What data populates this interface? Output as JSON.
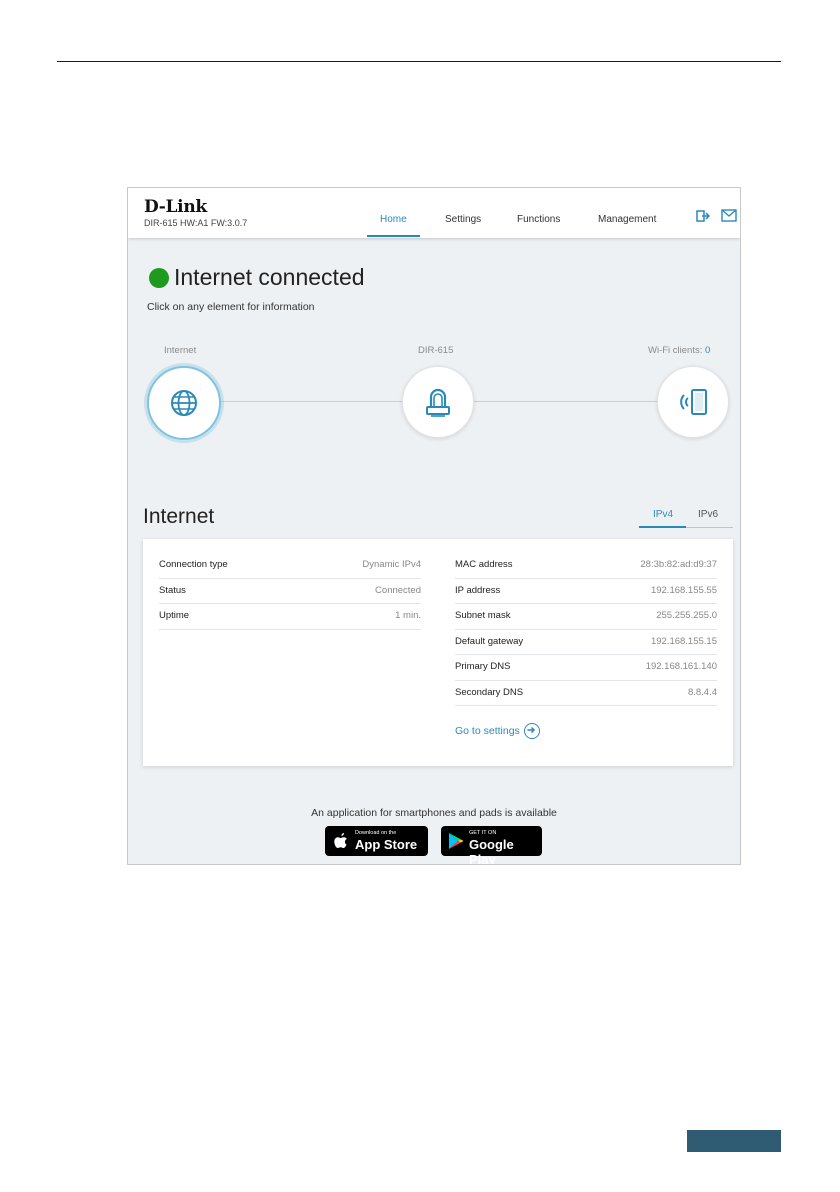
{
  "header": {
    "logo_text": "D-Link",
    "model_text": "DIR-615 HW:A1 FW:3.0.7",
    "nav": [
      {
        "label": "Home",
        "active": true
      },
      {
        "label": "Settings",
        "active": false
      },
      {
        "label": "Functions",
        "active": false
      },
      {
        "label": "Management",
        "active": false
      }
    ],
    "icons": [
      "logout-icon",
      "mail-icon"
    ]
  },
  "status": {
    "title": "Internet connected",
    "color": "#1e9a1e",
    "hint": "Click on any element for information"
  },
  "topology": {
    "internet_label": "Internet",
    "router_label": "DIR-615",
    "wifi_label": "Wi-Fi clients:",
    "wifi_count": "0"
  },
  "section": {
    "title": "Internet",
    "tabs": [
      {
        "label": "IPv4",
        "active": true
      },
      {
        "label": "IPv6",
        "active": false
      }
    ]
  },
  "left_table": [
    {
      "key": "Connection type",
      "value": "Dynamic IPv4"
    },
    {
      "key": "Status",
      "value": "Connected"
    },
    {
      "key": "Uptime",
      "value": "1 min."
    }
  ],
  "right_table": [
    {
      "key": "MAC address",
      "value": "28:3b:82:ad:d9:37"
    },
    {
      "key": "IP address",
      "value": "192.168.155.55"
    },
    {
      "key": "Subnet mask",
      "value": "255.255.255.0"
    },
    {
      "key": "Default gateway",
      "value": "192.168.155.15"
    },
    {
      "key": "Primary DNS",
      "value": "192.168.161.140"
    },
    {
      "key": "Secondary DNS",
      "value": "8.8.4.4"
    }
  ],
  "goto_settings": "Go to settings",
  "apps": {
    "note": "An application for smartphones and pads is available",
    "appstore_small": "Download on the",
    "appstore_big": "App Store",
    "googleplay_small": "GET IT ON",
    "googleplay_big": "Google Play"
  },
  "colors": {
    "accent": "#2a8ab7",
    "page_bar": "#2f5b73"
  }
}
